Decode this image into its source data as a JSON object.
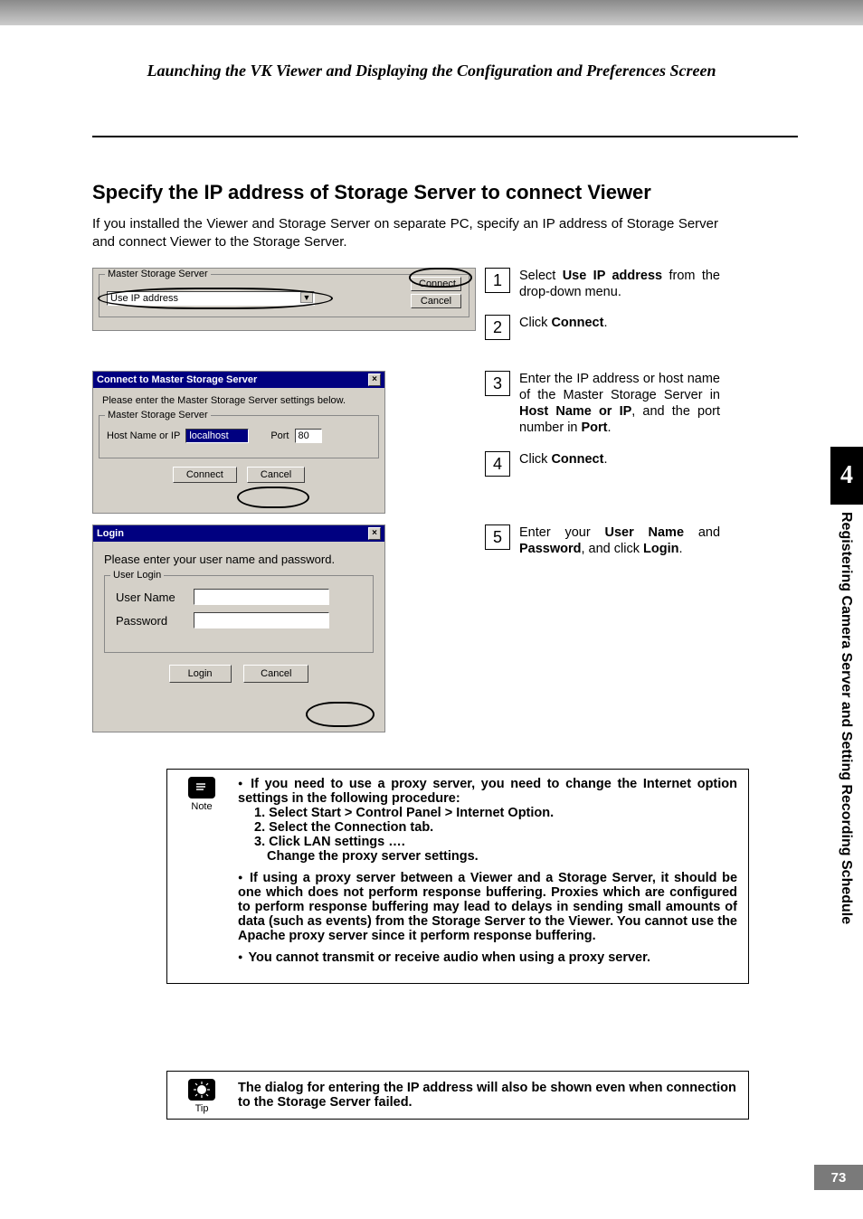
{
  "header": {
    "running_title": "Launching the VK Viewer and Displaying the Configuration and Preferences Screen"
  },
  "section": {
    "title": "Specify the IP address of Storage Server to connect Viewer",
    "intro": "If you installed the Viewer and Storage Server on separate PC, specify an IP address of Storage Server and connect Viewer to the Storage Server."
  },
  "dialog_master": {
    "group_label": "Master Storage Server",
    "dropdown_value": "Use IP address",
    "connect": "Connect",
    "cancel": "Cancel"
  },
  "dialog_connect": {
    "title": "Connect to Master Storage Server",
    "instruction": "Please enter the Master Storage Server settings below.",
    "group_label": "Master Storage Server",
    "host_label": "Host Name or IP",
    "host_value": "localhost",
    "port_label": "Port",
    "port_value": "80",
    "connect": "Connect",
    "cancel": "Cancel"
  },
  "dialog_login": {
    "title": "Login",
    "instruction": "Please enter your user name and password.",
    "group_label": "User Login",
    "user_label": "User Name",
    "pass_label": "Password",
    "login": "Login",
    "cancel": "Cancel"
  },
  "steps": {
    "s1_pre": "Select ",
    "s1_bold": "Use IP address",
    "s1_post": " from the drop-down menu.",
    "s2_pre": "Click ",
    "s2_bold": "Connect",
    "s2_post": ".",
    "s3_a": "Enter the IP address or host name of the Master Storage Server in ",
    "s3_b": "Host Name or IP",
    "s3_c": ", and the port number in ",
    "s3_d": "Port",
    "s3_e": ".",
    "s4_pre": "Click ",
    "s4_bold": "Connect",
    "s4_post": ".",
    "s5_a": "Enter your ",
    "s5_b": "User Name",
    "s5_c": " and ",
    "s5_d": "Password",
    "s5_e": ", and click ",
    "s5_f": "Login",
    "s5_g": "."
  },
  "note": {
    "label": "Note",
    "b1": "If you need to use a proxy server, you need to change the Internet option settings in the following procedure:",
    "n1": "1. Select Start  > Control Panel > Internet Option.",
    "n2": "2. Select the Connection tab.",
    "n3": "3. Click LAN settings ….",
    "n3b": "Change the proxy server settings.",
    "b2": "If using a proxy server between a Viewer and a Storage Server, it should be one which does not perform response buffering. Proxies which are configured to perform response buffering may lead to delays in sending small amounts of data (such as events) from the Storage Server to the Viewer. You cannot use the Apache proxy server since it perform response buffering.",
    "b3": "You cannot transmit or receive audio when using a proxy server."
  },
  "tip": {
    "label": "Tip",
    "text": "The dialog for entering the IP address will also be shown even when connection to the Storage Server failed."
  },
  "side": {
    "chapter_number": "4",
    "chapter_title": "Registering Camera Server and Setting Recording Schedule"
  },
  "page_number": "73"
}
